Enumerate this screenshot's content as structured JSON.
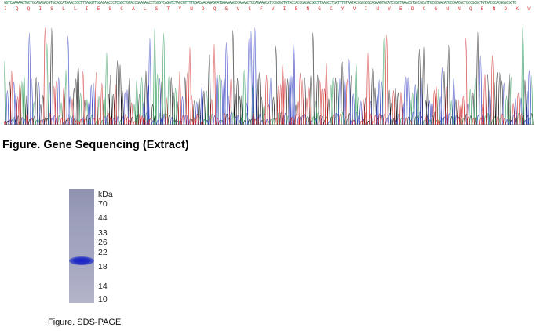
{
  "sequence": {
    "dna": "GGTCAAAAACTGCTGCAGAGACGTGCACCATAAACCGCTTTAGGTTGCACAACCCTCGGCTGTACCGAAGAACCTGGGTCAGGTCTACCGTTTTGGACAACAGAGGATGGAAAAGCGAAAACTGCAGAAGCATCGGCGCTGTACCACCGAGACGGCTTAAGCCTGATTTGTAATACCGCGCGCAGAAGTGCATCGGCTGAACGTGCCGCATTGCGCGACATGCCAACGCTGCCGCGCTGTAACGCACGGGCGCTG",
    "amino_acids": "I Q Q I S L L I E S C A L S T Y N D Q S V S F V I E N G C Y V I N V E D C G N N Q E N D K V L I K Y Y E S S F P A Q S S D V D G K K L N V H N S P I K D T D I W L N A N D K D Y",
    "caption": "Figure. Gene Sequencing (Extract)"
  },
  "gel": {
    "unit_label": "kDa",
    "markers": [
      "70",
      "44",
      "33",
      "26",
      "22",
      "18",
      "14",
      "10"
    ],
    "caption": "Figure. SDS-PAGE",
    "band_color": "#1a20c8"
  },
  "colors": {
    "trace_black": "#111111",
    "trace_green": "#2e9a5a",
    "trace_blue": "#3140c0",
    "trace_red": "#d02a2a"
  }
}
